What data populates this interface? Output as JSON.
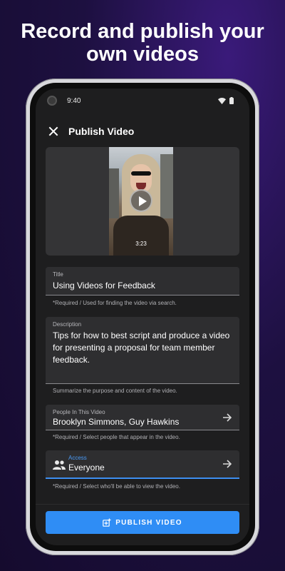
{
  "promo": {
    "headline_line1": "Record and publish your",
    "headline_line2": "own videos"
  },
  "status_bar": {
    "time": "9:40"
  },
  "app_bar": {
    "title": "Publish Video"
  },
  "video": {
    "duration": "3:23"
  },
  "form": {
    "title": {
      "label": "Title",
      "value": "Using Videos for Feedback",
      "helper": "*Required / Used for finding the video via search."
    },
    "description": {
      "label": "Description",
      "value": "Tips for how to best script and produce a video for presenting a proposal for team member feedback.",
      "helper": "Summarize the purpose and content of the video."
    },
    "people": {
      "label": "People In This Video",
      "value": "Brooklyn Simmons, Guy Hawkins",
      "helper": "*Required / Select people that appear in the video."
    },
    "access": {
      "label": "Access",
      "value": "Everyone",
      "helper": "*Required / Select who'll be able to view the video."
    }
  },
  "actions": {
    "publish_label": "PUBLISH VIDEO"
  },
  "colors": {
    "accent": "#2f8df5",
    "background": "#1e1e1f",
    "field_bg": "#2e2e30"
  },
  "icons": [
    "close-icon",
    "wifi-icon",
    "battery-icon",
    "play-icon",
    "arrow-right-icon",
    "people-icon",
    "publish-icon"
  ]
}
